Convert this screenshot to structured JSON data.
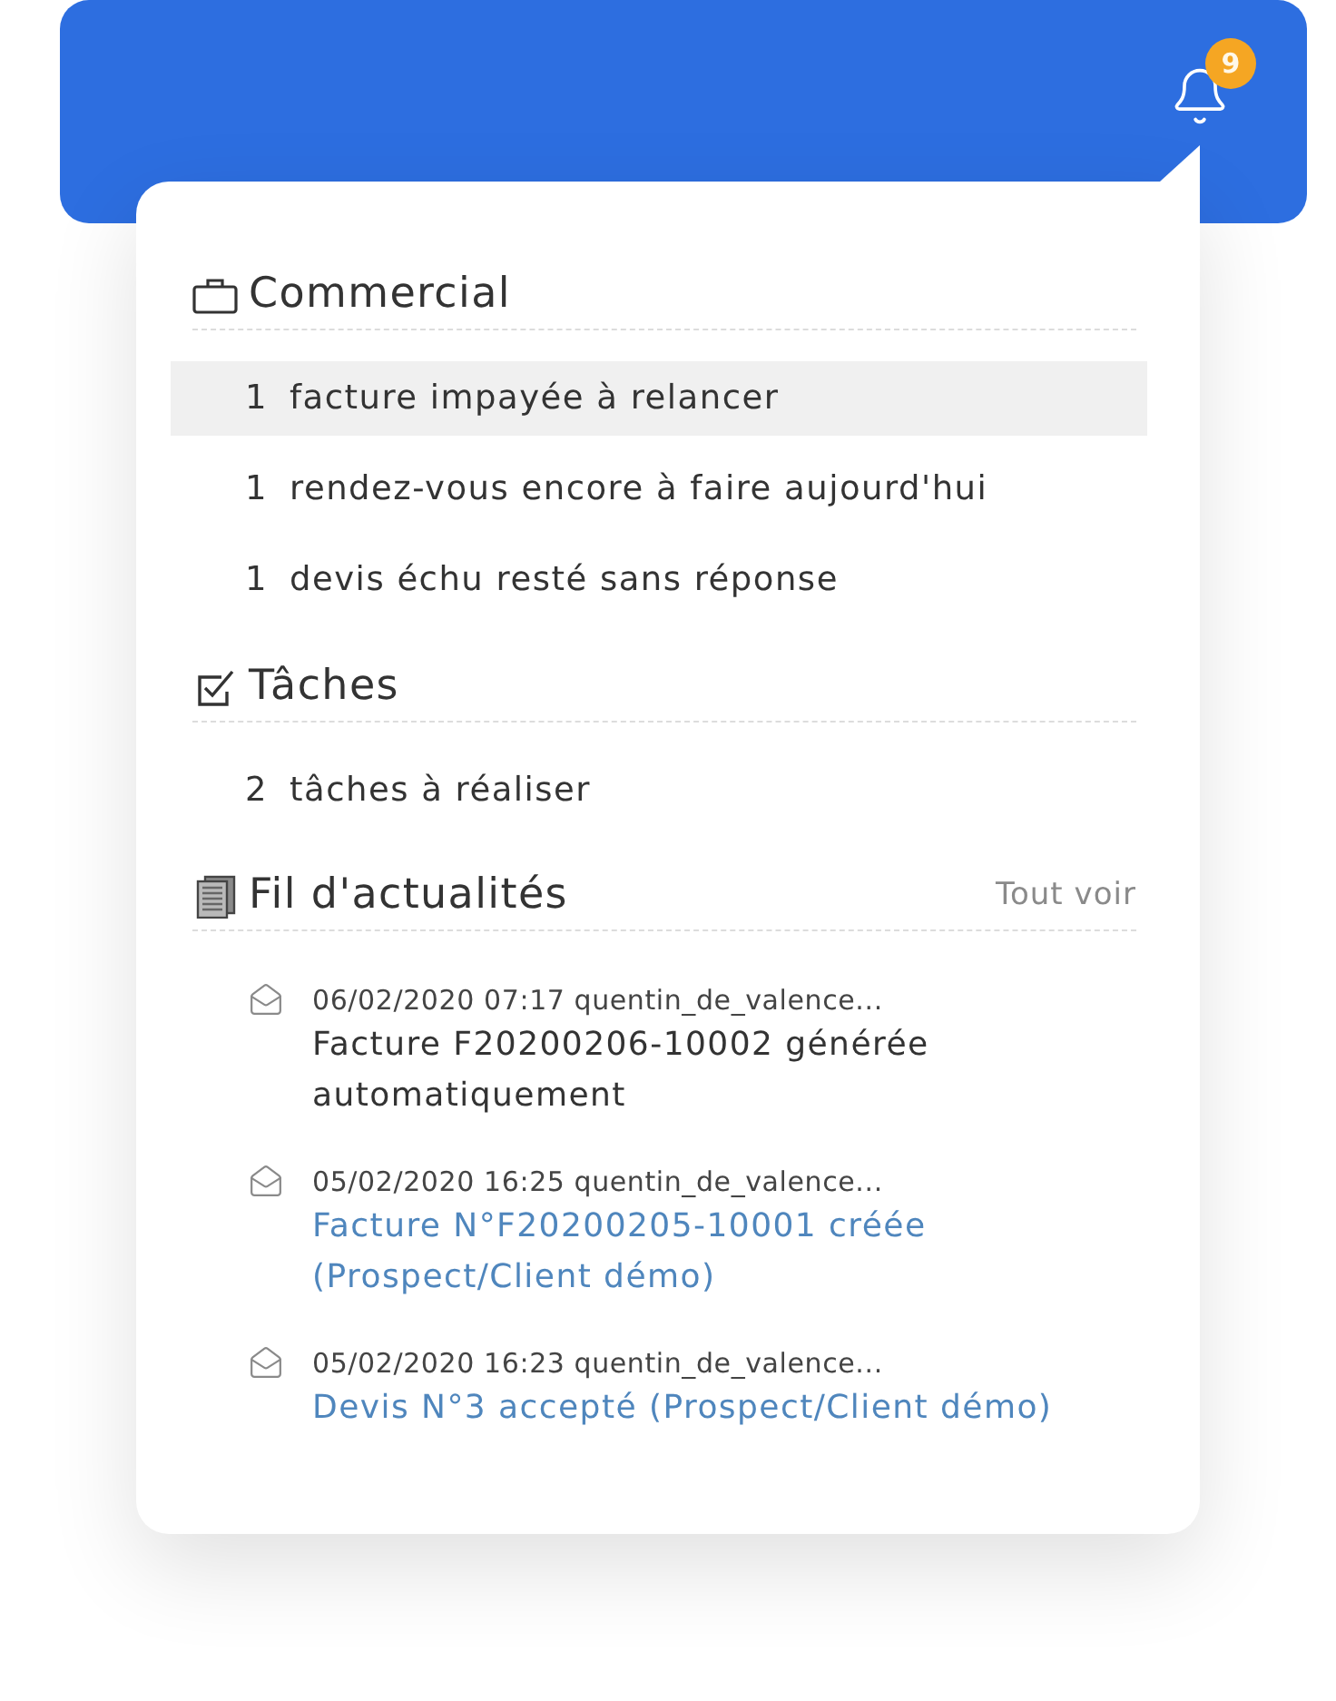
{
  "header": {
    "badge": "9"
  },
  "commercial": {
    "title": "Commercial",
    "items": [
      {
        "count": "1",
        "label": "facture impayée à relancer",
        "selected": true
      },
      {
        "count": "1",
        "label": "rendez-vous encore à faire aujourd'hui",
        "selected": false
      },
      {
        "count": "1",
        "label": "devis échu resté sans réponse",
        "selected": false
      }
    ]
  },
  "taches": {
    "title": "Tâches",
    "items": [
      {
        "count": "2",
        "label": "tâches à réaliser",
        "selected": false
      }
    ]
  },
  "fil_actualites": {
    "title": "Fil d'actualités",
    "link": "Tout voir",
    "items": [
      {
        "date": "06/02/2020 07:17",
        "author": "quentin_de_valence...",
        "message": "Facture F20200206-10002 générée automatiquement",
        "kind": "text"
      },
      {
        "date": "05/02/2020 16:25",
        "author": "quentin_de_valence...",
        "message": "Facture N°F20200205-10001 créée (Prospect/Client démo)",
        "kind": "link"
      },
      {
        "date": "05/02/2020 16:23",
        "author": "quentin_de_valence...",
        "message": "Devis N°3 accepté (Prospect/Client démo)",
        "kind": "link"
      }
    ]
  }
}
